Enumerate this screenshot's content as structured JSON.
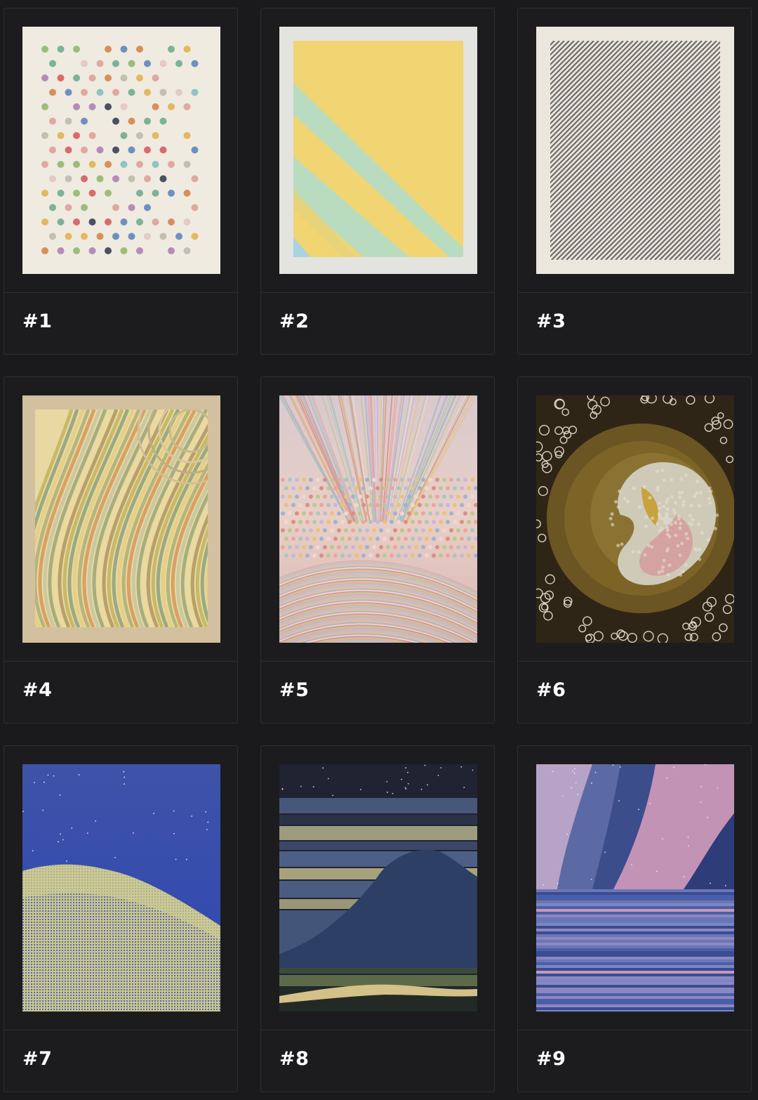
{
  "cards": [
    {
      "label": "#1",
      "art": "dots-grid"
    },
    {
      "label": "#2",
      "art": "yellow-diagonal"
    },
    {
      "label": "#3",
      "art": "grey-diagonal-lines"
    },
    {
      "label": "#4",
      "art": "flowing-stripes"
    },
    {
      "label": "#5",
      "art": "pastel-burst"
    },
    {
      "label": "#6",
      "art": "circle-swirl"
    },
    {
      "label": "#7",
      "art": "blue-night-hill"
    },
    {
      "label": "#8",
      "art": "dark-wave-stripes"
    },
    {
      "label": "#9",
      "art": "aurora-sea"
    }
  ],
  "colors": {
    "background": "#1a1a1c",
    "card": "#1c1c1e",
    "border": "#2e2e31",
    "label": "#ffffff"
  }
}
